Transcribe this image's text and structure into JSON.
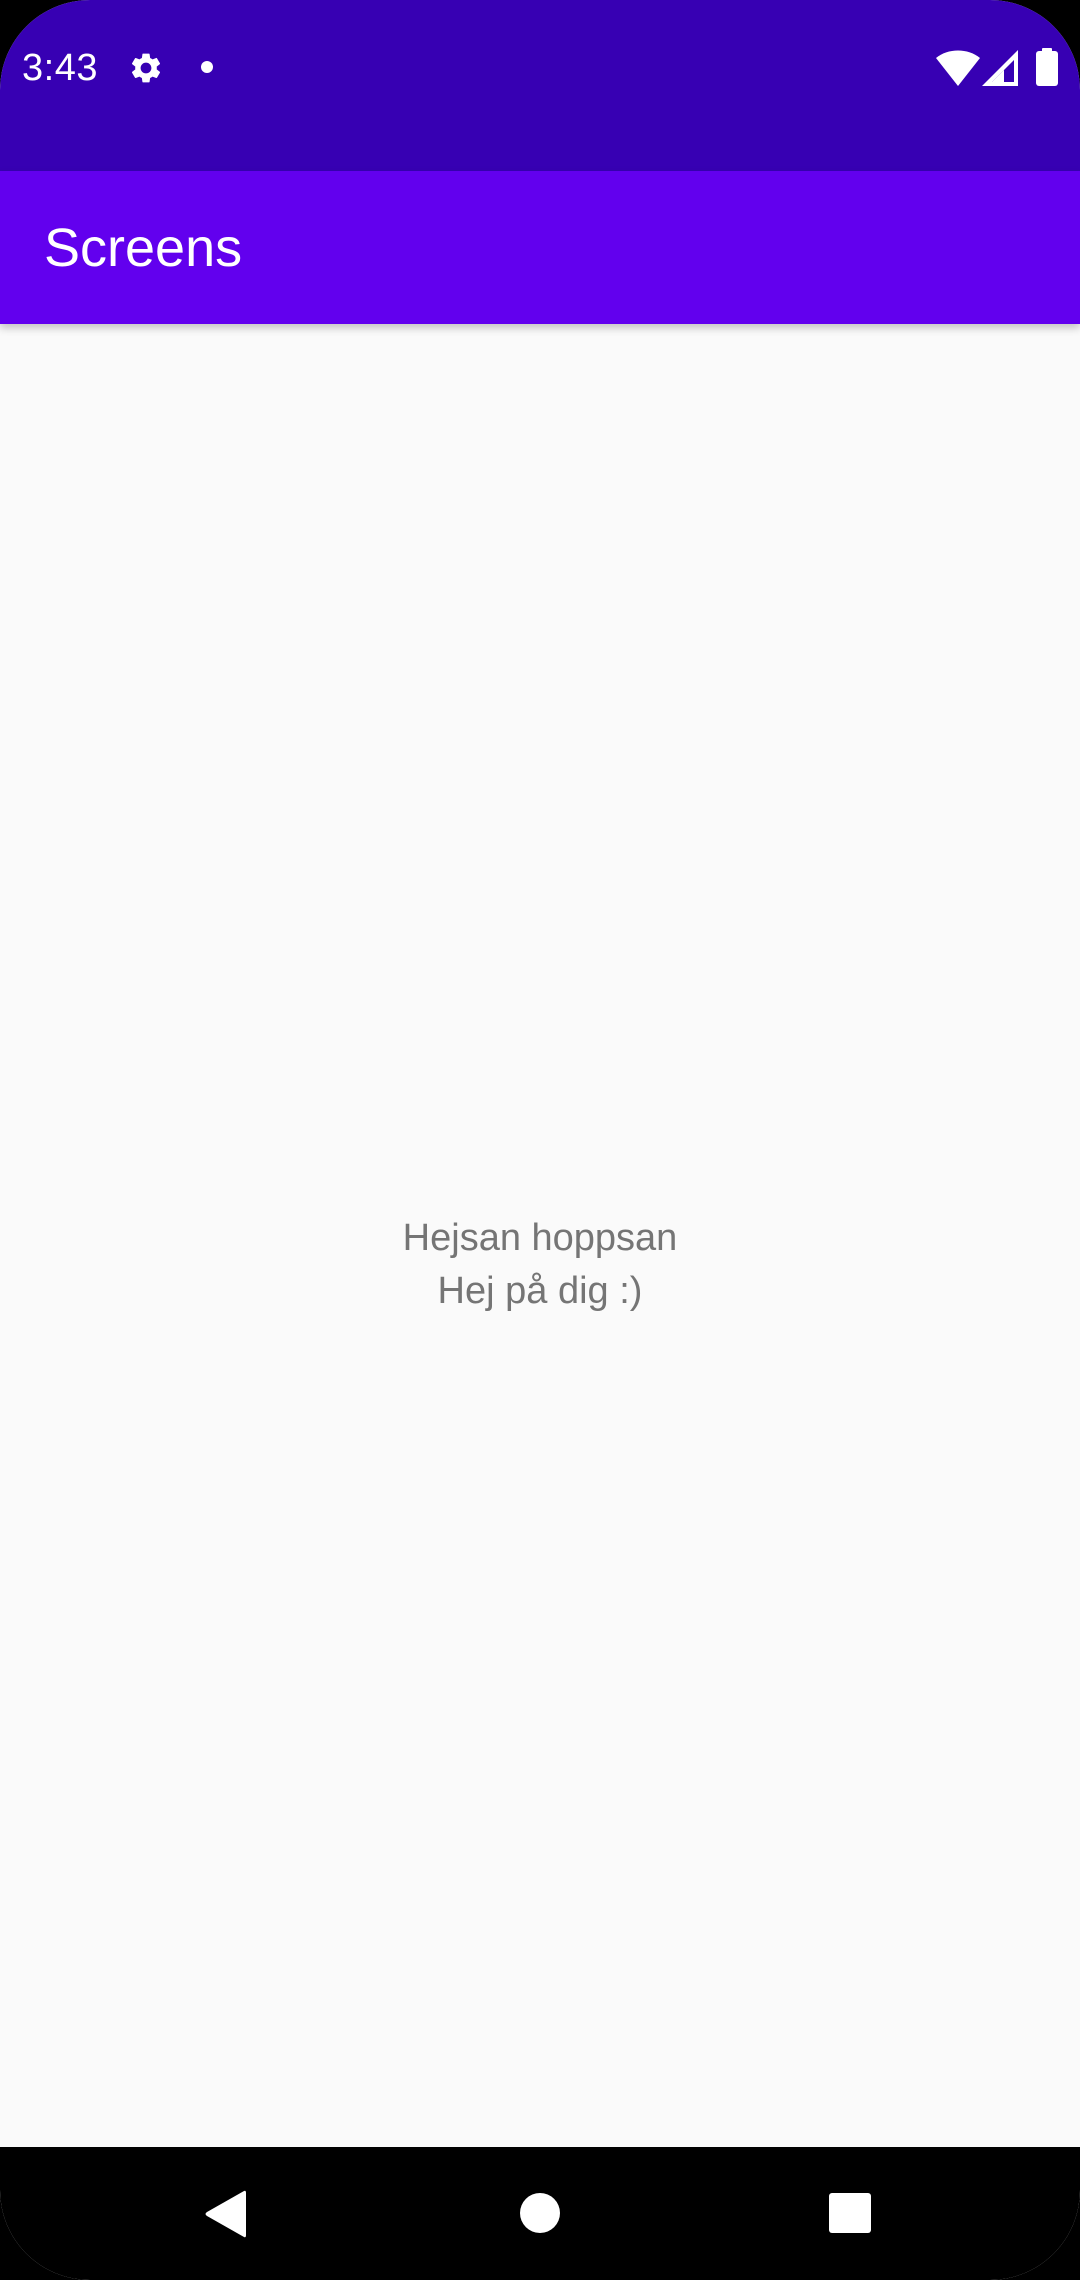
{
  "status_bar": {
    "time": "3:43",
    "icons": [
      "settings-gear-icon",
      "notification-dot-icon",
      "wifi-icon",
      "cell-signal-icon",
      "battery-icon"
    ],
    "background": "#3700b3"
  },
  "app_bar": {
    "title": "Screens",
    "background": "#6200ee"
  },
  "content": {
    "message_line1": "Hejsan hoppsan",
    "message_line2": "Hej på dig :)",
    "text_color": "#757575",
    "background": "#fafafa"
  },
  "nav_bar": {
    "buttons": [
      "back-icon",
      "home-icon",
      "recents-icon"
    ],
    "background": "#000000"
  }
}
